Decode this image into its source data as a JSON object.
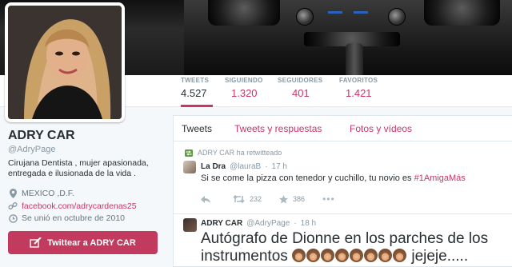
{
  "profile": {
    "name": "ADRY CAR",
    "handle": "@AdryPage",
    "bio": "Cirujana Dentista , mujer apasionada, entregada e ilusionada de la vida .",
    "location": "MEXICO ,D.F.",
    "url": "facebook.com/adrycardenas25",
    "joined": "Se unió en octubre de 2010",
    "tweet_button": "Twittear a ADRY CAR"
  },
  "stats": [
    {
      "label": "TWEETS",
      "value": "4.527"
    },
    {
      "label": "SIGUIENDO",
      "value": "1.320"
    },
    {
      "label": "SEGUIDORES",
      "value": "401"
    },
    {
      "label": "FAVORITOS",
      "value": "1.421"
    }
  ],
  "tabs": [
    "Tweets",
    "Tweets y respuestas",
    "Fotos y vídeos"
  ],
  "tweets": [
    {
      "retweet_label": "ADRY CAR ha retwitteado",
      "author": "La Dra",
      "handle": "@lauraB",
      "time": "17 h",
      "text": "Si se come la pizza con tenedor y cuchillo, tu novio es ",
      "hashtag": "#1AmigaMás",
      "retweets": "232",
      "favorites": "386"
    },
    {
      "author": "ADRY CAR",
      "handle": "@AdryPage",
      "time": "18 h",
      "text_line1": "Autógrafo de Dionne en los parches de los",
      "text_line2_start": "instrumentos",
      "text_line2_end": "jejeje....."
    }
  ],
  "colors": {
    "accent": "#cc3366",
    "button": "#c23a5e"
  }
}
